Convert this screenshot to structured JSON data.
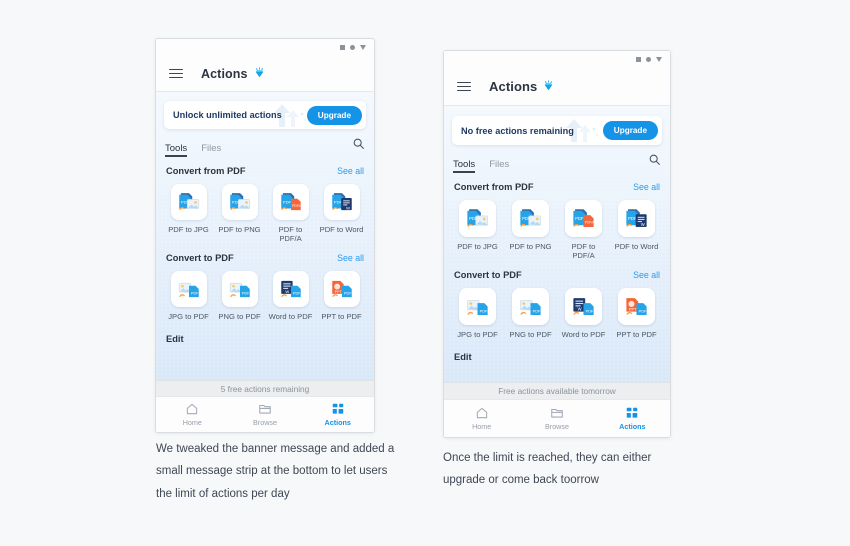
{
  "page": {
    "background": "#f7f8f9"
  },
  "colors": {
    "accent": "#1593e6",
    "link": "#2a9bef",
    "text_dark": "#2b3440",
    "text_muted": "#8e98a5",
    "banner_text": "#1d3b63",
    "strip_bg": "#eceef0"
  },
  "shared": {
    "app_title": "Actions",
    "menu_icon": "hamburger-icon",
    "logo_icon": "gem-icon",
    "search_icon": "search-icon",
    "statusbar_icons": [
      "square-icon",
      "circle-icon",
      "triangle-down-icon"
    ],
    "tabs": [
      {
        "label": "Tools",
        "active": true
      },
      {
        "label": "Files",
        "active": false
      }
    ],
    "see_all_label": "See all",
    "upgrade_label": "Upgrade",
    "sections": [
      {
        "title": "Convert from PDF",
        "tools": [
          {
            "label": "PDF to JPG",
            "icon": "pdf-to-jpg-icon"
          },
          {
            "label": "PDF to PNG",
            "icon": "pdf-to-png-icon"
          },
          {
            "label": "PDF to PDF/A",
            "icon": "pdf-to-pdfa-icon"
          },
          {
            "label": "PDF to Word",
            "icon": "pdf-to-word-icon"
          }
        ]
      },
      {
        "title": "Convert to PDF",
        "tools": [
          {
            "label": "JPG to PDF",
            "icon": "jpg-to-pdf-icon"
          },
          {
            "label": "PNG to PDF",
            "icon": "png-to-pdf-icon"
          },
          {
            "label": "Word to PDF",
            "icon": "word-to-pdf-icon"
          },
          {
            "label": "PPT to PDF",
            "icon": "ppt-to-pdf-icon"
          }
        ]
      }
    ],
    "edit_section_title": "Edit",
    "bottom_nav": [
      {
        "label": "Home",
        "icon": "home-icon",
        "active": false
      },
      {
        "label": "Browse",
        "icon": "folder-icon",
        "active": false
      },
      {
        "label": "Actions",
        "icon": "grid-icon",
        "active": true
      }
    ]
  },
  "phone_a": {
    "banner_message": "Unlock unlimited actions",
    "strip_message": "5 free actions remaining"
  },
  "phone_b": {
    "banner_message": "No free actions remaining",
    "strip_message": "Free actions available tomorrow"
  },
  "captions": {
    "a": "We tweaked the banner message and added a small message strip at the bottom to let users the limit of actions per day",
    "b": "Once the limit is reached, they can either upgrade or come back toorrow"
  }
}
